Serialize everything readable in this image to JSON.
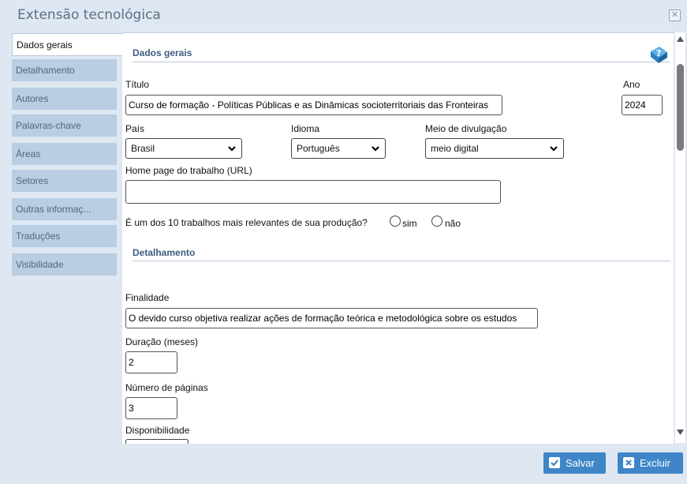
{
  "window": {
    "title": "Extensão tecnológica",
    "close_icon": "close-icon"
  },
  "tabs": [
    {
      "label": "Dados gerais",
      "active": true
    },
    {
      "label": "Detalhamento"
    },
    {
      "label": "Autores"
    },
    {
      "label": "Palavras-chave"
    },
    {
      "label": "Áreas"
    },
    {
      "label": "Setores"
    },
    {
      "label": "Outras informaç..."
    },
    {
      "label": "Traduções"
    },
    {
      "label": "Visibilidade"
    }
  ],
  "dados_gerais": {
    "heading": "Dados gerais",
    "titulo_label": "Título",
    "titulo_value": "Curso de formação - Políticas Públicas e as Dinâmicas socioterritoriais das Fronteiras",
    "ano_label": "Ano",
    "ano_value": "2024",
    "pais_label": "País",
    "pais_value": "Brasil",
    "idioma_label": "Idioma",
    "idioma_value": "Português",
    "meio_label": "Meio de divulgação",
    "meio_value": "meio digital",
    "homepage_label": "Home page do trabalho (URL)",
    "homepage_value": "",
    "relevante_label": "É um dos 10 trabalhos mais relevantes de sua produção?",
    "sim_label": "sim",
    "nao_label": "não"
  },
  "detalhamento": {
    "heading": "Detalhamento",
    "finalidade_label": "Finalidade",
    "finalidade_value": "O devido curso objetiva realizar ações de formação teórica e metodológica sobre os estudos",
    "duracao_label": "Duração (meses)",
    "duracao_value": "2",
    "paginas_label": "Número de páginas",
    "paginas_value": "3",
    "disponibilidade_label": "Disponibilidade"
  },
  "footer": {
    "save_label": "Salvar",
    "delete_label": "Excluir"
  },
  "colors": {
    "accent": "#3e86c8",
    "tab_bg": "#b9cde3",
    "heading": "#3d5c80"
  }
}
